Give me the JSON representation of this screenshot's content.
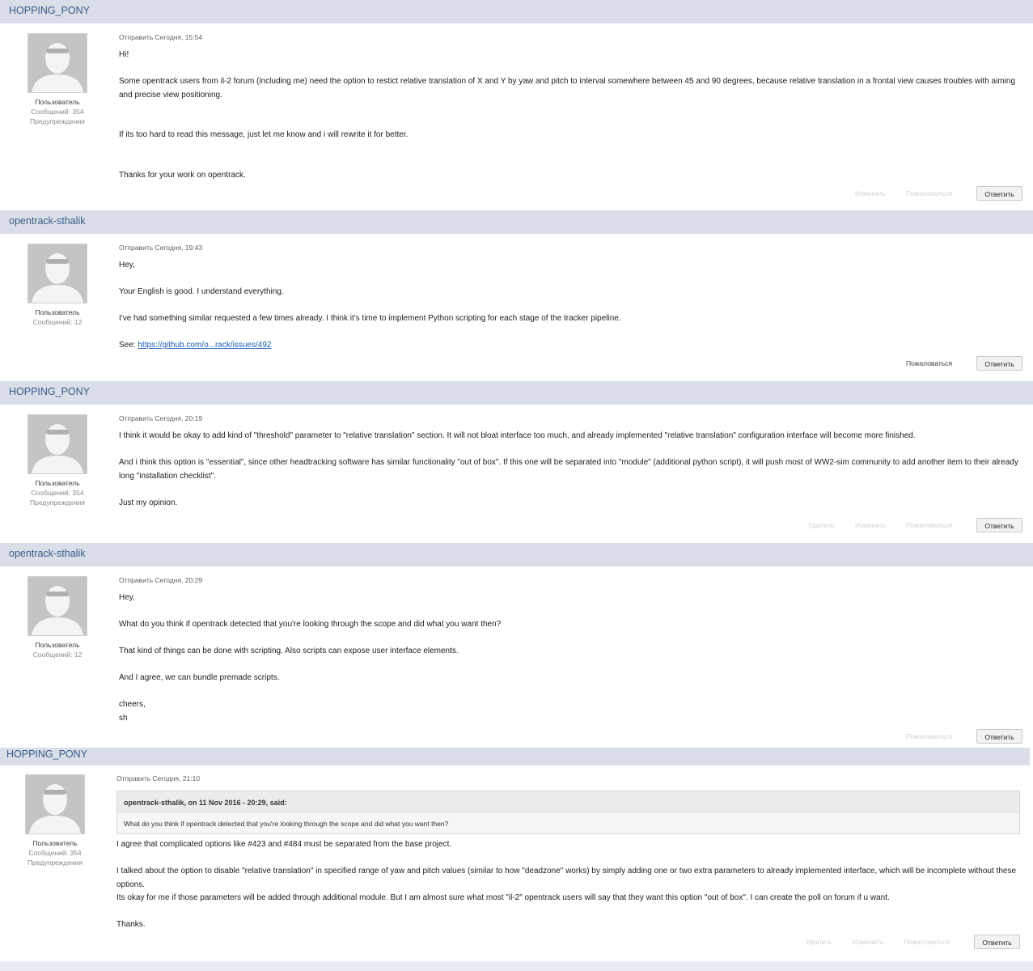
{
  "labels": {
    "reply": "Ответить",
    "report": "Пожаловаться",
    "edit": "Изменить",
    "delete": "Удалить"
  },
  "posts": [
    {
      "author": "HOPPING_PONY",
      "role": "Пользователь",
      "post_count": "Сообщений: 354",
      "warnings": "Предупреждения",
      "posted": "Отправить Сегодня, 15:54",
      "paragraphs": [
        "Hi!",
        "Some opentrack users from il-2 forum (including me) need the option to restict relative translation of X and Y by yaw and pitch to interval somewhere between 45 and 90 degrees, because relative translation in a frontal view causes troubles with aiming and precise view positioning.",
        "If its too hard to read this message, just let me know and i will rewrite it for better.",
        "Thanks for your work on opentrack."
      ]
    },
    {
      "author": "opentrack-sthalik",
      "role": "Пользователь",
      "post_count": "Сообщений: 12",
      "posted": "Отправить Сегодня, 19:43",
      "paragraphs": [
        "Hey,",
        "Your English is good. I understand everything.",
        "I've had something similar requested a few times already. I think it's time to implement Python scripting for each stage of the tracker pipeline."
      ],
      "see_label": "See: ",
      "link_text": "https://github.com/o...rack/issues/492"
    },
    {
      "author": "HOPPING_PONY",
      "role": "Пользователь",
      "post_count": "Сообщений: 354",
      "warnings": "Предупреждения",
      "posted": "Отправить Сегодня, 20:19",
      "paragraphs": [
        "I think it would be okay to add kind of \"threshold\" parameter to \"relative translation\" section. It will not bloat interface too much, and already implemented \"relative translation\" configuration interface will become more finished.",
        "And i think this option is \"essential\", since other headtracking software has similar functionality \"out of box\". If this one will be separated into \"module\" (additional python script), it will push most of WW2-sim community to add another item to their already long \"installation checklist\".",
        "Just my opinion."
      ]
    },
    {
      "author": "opentrack-sthalik",
      "role": "Пользователь",
      "post_count": "Сообщений: 12",
      "posted": "Отправить Сегодня, 20:29",
      "paragraphs": [
        "Hey,",
        "What do you think if opentrack detected that you're looking through the scope and did what you want then?",
        "That kind of things can be done with scripting. Also scripts can expose user interface elements.",
        "And I agree, we can bundle premade scripts.",
        "cheers,",
        "sh"
      ]
    },
    {
      "author": "HOPPING_PONY",
      "role": "Пользователь",
      "post_count": "Сообщений: 354",
      "warnings": "Предупреждения",
      "posted": "Отправить Сегодня, 21:10",
      "quote_header": "opentrack-sthalik, on 11 Nov 2016 - 20:29, said:",
      "quote_text": "What do you think if opentrack detected that you're looking through the scope and did what you want then?",
      "paragraphs": [
        "I agree that complicated options like #423 and #484 must be separated from the base project.",
        "I talked about the option to disable \"relative translation\" in specified range of yaw and pitch values (similar to how \"deadzone\" works) by simply adding one or two extra parameters to already implemented interface, which will be incomplete without these options.",
        "Its okay for me if those parameters will be added through additional module. But I am almost sure what most \"il-2\" opentrack users will say that they want this option \"out of box\". I can create the poll on forum if u want.",
        "Thanks."
      ]
    }
  ]
}
